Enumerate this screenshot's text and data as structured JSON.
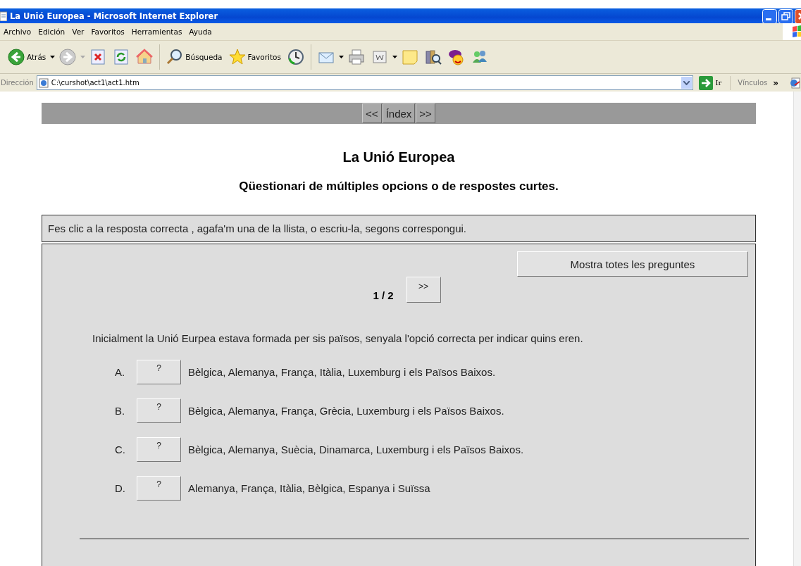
{
  "window": {
    "title": "La Unió Europea - Microsoft Internet Explorer"
  },
  "menu": [
    "Archivo",
    "Edición",
    "Ver",
    "Favoritos",
    "Herramientas",
    "Ayuda"
  ],
  "toolbar": [
    {
      "kind": "back",
      "label": "Atrás",
      "dropdown": true
    },
    {
      "kind": "forward",
      "dropdown": true
    },
    {
      "kind": "stop"
    },
    {
      "kind": "refresh"
    },
    {
      "kind": "home"
    },
    {
      "kind": "sep"
    },
    {
      "kind": "search",
      "label": "Búsqueda"
    },
    {
      "kind": "favorites",
      "label": "Favoritos"
    },
    {
      "kind": "history"
    },
    {
      "kind": "sep"
    },
    {
      "kind": "mail",
      "dropdown": true
    },
    {
      "kind": "print"
    },
    {
      "kind": "word",
      "dropdown": true
    },
    {
      "kind": "note"
    },
    {
      "kind": "research"
    },
    {
      "kind": "yahoo"
    },
    {
      "kind": "messenger"
    }
  ],
  "address_bar": {
    "label": "Dirección",
    "value": "C:\\curshot\\act1\\act1.htm",
    "go": "Ir",
    "links": "Vínculos",
    "links_more": "»"
  },
  "nav": [
    "<<",
    "Índex",
    ">>"
  ],
  "page": {
    "title": "La Unió Europea",
    "subtitle": "Qüestionari de múltiples opcions o de respostes curtes.",
    "instructions": "Fes clic a la resposta correcta , agafa'm una de la llista, o escriu-la, segons correspongui."
  },
  "quiz": {
    "show_all": "Mostra totes les preguntes",
    "counter": "1 / 2",
    "next": ">>",
    "question": "Inicialment la Unió Eurpea estava formada per sis països, senyala l'opció correcta per indicar quins eren.",
    "options": [
      {
        "letter": "A.",
        "button": "?",
        "text": "Bèlgica, Alemanya, França, Itàlia, Luxemburg i els Països Baixos."
      },
      {
        "letter": "B.",
        "button": "?",
        "text": "Bèlgica, Alemanya, França, Grècia, Luxemburg i els Països Baixos."
      },
      {
        "letter": "C.",
        "button": "?",
        "text": "Bèlgica, Alemanya, Suècia, Dinamarca, Luxemburg i els Països Baixos."
      },
      {
        "letter": "D.",
        "button": "?",
        "text": "Alemanya, França, Itàlia, Bèlgica, Espanya i Suïssa"
      }
    ]
  }
}
